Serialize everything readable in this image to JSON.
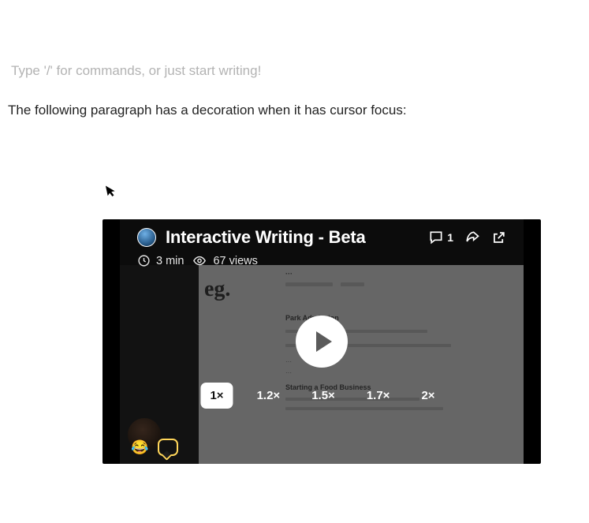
{
  "editor": {
    "placeholder": "Type '/' for commands, or just start writing!",
    "body_line": "The following paragraph has a decoration when it has cursor focus:"
  },
  "video": {
    "title": "Interactive Writing - Beta",
    "duration": "3 min",
    "views": "67 views",
    "comment_count": "1",
    "speeds": [
      "1×",
      "1.2×",
      "1.5×",
      "1.7×",
      "2×"
    ],
    "active_speed_index": 0,
    "reaction_emoji": "😂",
    "background": {
      "logo": "eg.",
      "headline": "Park Admission",
      "line2_left": "Starting a Food Business"
    }
  }
}
